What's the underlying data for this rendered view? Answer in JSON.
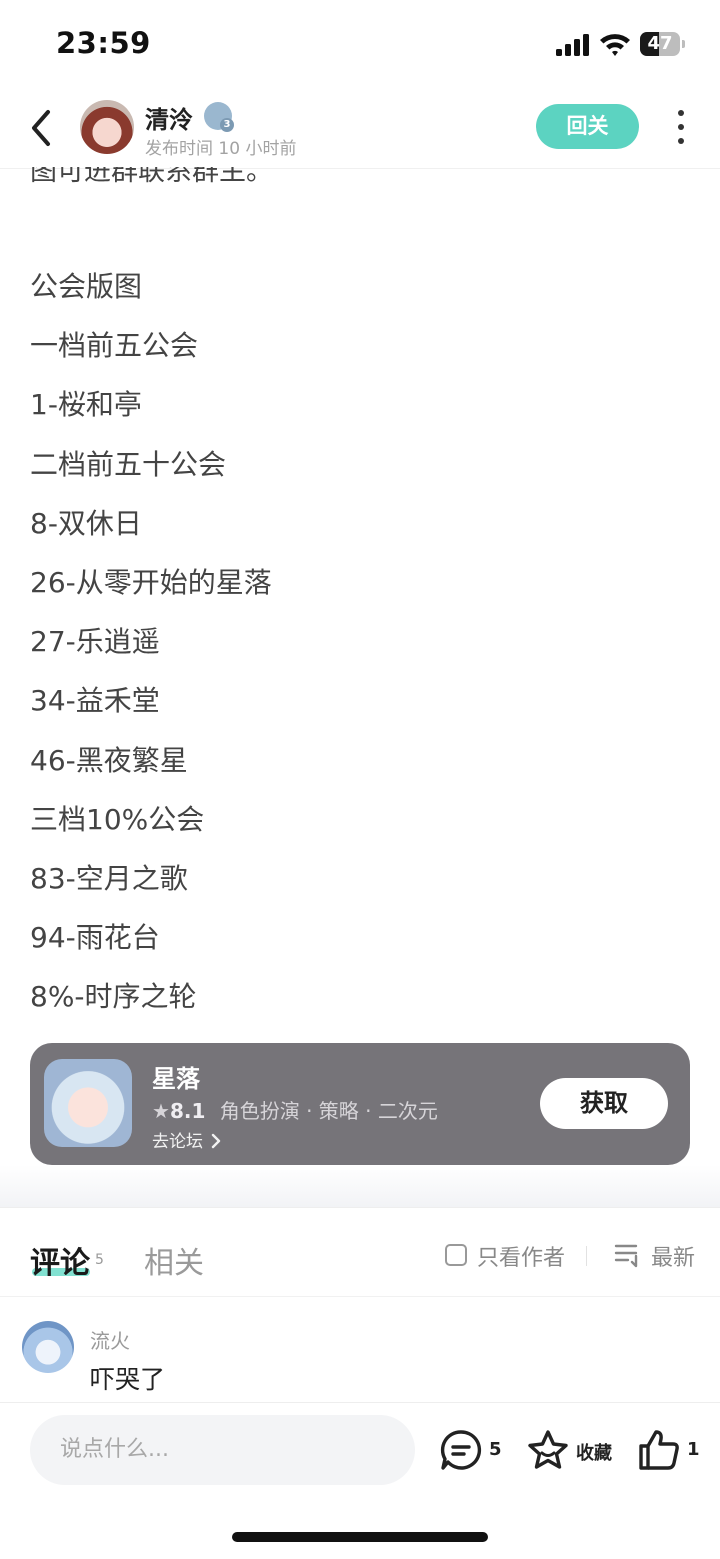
{
  "status_bar": {
    "time": "23:59",
    "battery": "47",
    "battery_level": 0.47
  },
  "header": {
    "author": "清泠",
    "level_badge": "3",
    "publish_time": "发布时间 10 小时前",
    "follow_label": "回关"
  },
  "article": {
    "cut_line": "图可进群联系群主。",
    "lines": [
      "公会版图",
      "一档前五公会",
      "1-桜和亭",
      "二档前五十公会",
      "8-双休日",
      "26-从零开始的星落",
      "27-乐逍遥",
      "34-益禾堂",
      "46-黑夜繁星",
      "三档10%公会",
      "83-空月之歌",
      "94-雨花台",
      "8%-时序之轮"
    ]
  },
  "game_card": {
    "name": "星落",
    "rating": "8.1",
    "tags": "角色扮演 · 策略 · 二次元",
    "forum_link": "去论坛",
    "get_label": "获取"
  },
  "comments_section": {
    "tab_comments": "评论",
    "comments_count": "5",
    "tab_related": "相关",
    "author_only": "只看作者",
    "sort_label": "最新",
    "items": [
      {
        "user": "流火",
        "text": "吓哭了"
      }
    ]
  },
  "bottom_bar": {
    "input_placeholder": "说点什么...",
    "comment_count": "5",
    "favorite_label": "收藏",
    "like_count": "1"
  },
  "icons": {
    "back": "chevron-left-icon",
    "more": "more-vertical-icon",
    "comment": "comment-bubble-icon",
    "favorite": "star-icon",
    "like": "thumbs-up-icon",
    "sort": "sort-list-icon"
  },
  "colors": {
    "accent": "#5cd3c1",
    "card_bg": "#767479"
  }
}
